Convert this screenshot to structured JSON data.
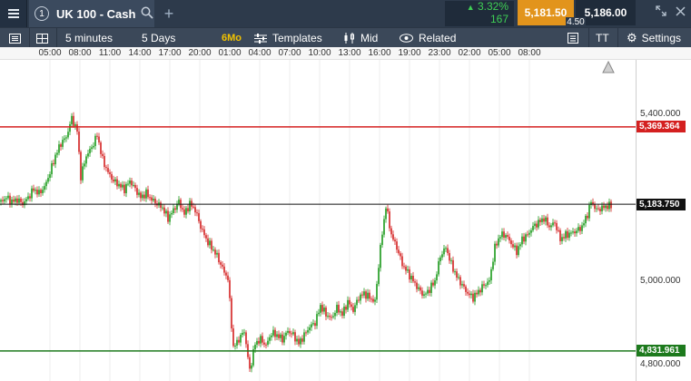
{
  "header": {
    "tab_number": "1",
    "instrument": "UK 100 - Cash",
    "change_pct": "3.32%",
    "change_points": "167",
    "bid": "5,181.50",
    "spread": "4.50",
    "ask": "5,186.00",
    "icons": [
      "menu-icon",
      "search-icon",
      "plus-icon",
      "expand-icon",
      "close-icon"
    ]
  },
  "toolbar": {
    "interval": "5 minutes",
    "range": "5 Days",
    "badge": "6Mo",
    "templates": "Templates",
    "price_type": "Mid",
    "related": "Related",
    "settings": "Settings",
    "font_label": "TT"
  },
  "time_axis": [
    "05:00",
    "08:00",
    "11:00",
    "14:00",
    "17:00",
    "20:00",
    "01:00",
    "04:00",
    "07:00",
    "10:00",
    "13:00",
    "16:00",
    "19:00",
    "23:00",
    "02:00",
    "05:00",
    "08:00"
  ],
  "price_axis": [
    "5,400.000",
    "5,000.000",
    "4,800.000"
  ],
  "levels": {
    "resistance": "5,369.364",
    "current": "5,183.750",
    "support": "4,831.961"
  },
  "colors": {
    "up": "#1a9a1a",
    "down": "#d42020",
    "resistance": "#d42020",
    "support": "#1d7a1d",
    "current": "#111111"
  },
  "chart_data": {
    "type": "candlestick",
    "ylim": [
      4760,
      5530
    ],
    "path": [
      [
        0,
        5190
      ],
      [
        6,
        5200
      ],
      [
        12,
        5190
      ],
      [
        18,
        5195
      ],
      [
        24,
        5185
      ],
      [
        30,
        5200
      ],
      [
        36,
        5220
      ],
      [
        42,
        5210
      ],
      [
        48,
        5225
      ],
      [
        54,
        5260
      ],
      [
        60,
        5300
      ],
      [
        66,
        5330
      ],
      [
        72,
        5345
      ],
      [
        78,
        5390
      ],
      [
        84,
        5360
      ],
      [
        88,
        5250
      ],
      [
        94,
        5300
      ],
      [
        100,
        5320
      ],
      [
        106,
        5350
      ],
      [
        112,
        5290
      ],
      [
        118,
        5260
      ],
      [
        124,
        5240
      ],
      [
        130,
        5230
      ],
      [
        136,
        5220
      ],
      [
        142,
        5240
      ],
      [
        148,
        5220
      ],
      [
        154,
        5200
      ],
      [
        160,
        5210
      ],
      [
        166,
        5195
      ],
      [
        172,
        5185
      ],
      [
        178,
        5175
      ],
      [
        184,
        5150
      ],
      [
        190,
        5170
      ],
      [
        196,
        5190
      ],
      [
        202,
        5160
      ],
      [
        208,
        5185
      ],
      [
        214,
        5170
      ],
      [
        220,
        5130
      ],
      [
        226,
        5100
      ],
      [
        232,
        5080
      ],
      [
        238,
        5060
      ],
      [
        244,
        5030
      ],
      [
        250,
        5005
      ],
      [
        256,
        4840
      ],
      [
        262,
        4860
      ],
      [
        268,
        4880
      ],
      [
        274,
        4785
      ],
      [
        280,
        4850
      ],
      [
        286,
        4860
      ],
      [
        292,
        4845
      ],
      [
        298,
        4875
      ],
      [
        304,
        4870
      ],
      [
        310,
        4860
      ],
      [
        316,
        4880
      ],
      [
        322,
        4870
      ],
      [
        328,
        4850
      ],
      [
        334,
        4870
      ],
      [
        340,
        4890
      ],
      [
        346,
        4900
      ],
      [
        352,
        4940
      ],
      [
        358,
        4920
      ],
      [
        364,
        4910
      ],
      [
        370,
        4935
      ],
      [
        376,
        4920
      ],
      [
        382,
        4950
      ],
      [
        388,
        4930
      ],
      [
        394,
        4960
      ],
      [
        400,
        4970
      ],
      [
        406,
        4960
      ],
      [
        412,
        4950
      ],
      [
        418,
        5080
      ],
      [
        424,
        5180
      ],
      [
        430,
        5110
      ],
      [
        436,
        5080
      ],
      [
        442,
        5040
      ],
      [
        448,
        5020
      ],
      [
        454,
        5000
      ],
      [
        460,
        4980
      ],
      [
        466,
        4965
      ],
      [
        472,
        4980
      ],
      [
        478,
        5000
      ],
      [
        484,
        5060
      ],
      [
        490,
        5080
      ],
      [
        496,
        5040
      ],
      [
        502,
        5010
      ],
      [
        508,
        4990
      ],
      [
        514,
        4970
      ],
      [
        520,
        4960
      ],
      [
        526,
        4975
      ],
      [
        532,
        4990
      ],
      [
        538,
        5000
      ],
      [
        544,
        5080
      ],
      [
        550,
        5110
      ],
      [
        556,
        5110
      ],
      [
        562,
        5090
      ],
      [
        568,
        5070
      ],
      [
        574,
        5100
      ],
      [
        580,
        5110
      ],
      [
        586,
        5130
      ],
      [
        592,
        5140
      ],
      [
        598,
        5150
      ],
      [
        604,
        5130
      ],
      [
        610,
        5140
      ],
      [
        616,
        5100
      ],
      [
        622,
        5110
      ],
      [
        628,
        5115
      ],
      [
        634,
        5120
      ],
      [
        640,
        5130
      ],
      [
        646,
        5160
      ],
      [
        650,
        5190
      ],
      [
        656,
        5170
      ],
      [
        662,
        5175
      ],
      [
        668,
        5180
      ]
    ]
  }
}
